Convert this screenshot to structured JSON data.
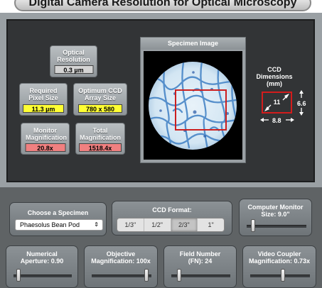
{
  "header": {
    "title": "Digital Camera Resolution for Optical Microscopy"
  },
  "readouts": {
    "optical_resolution": {
      "label": "Optical Resolution",
      "value": "0.3 µm"
    },
    "required_pixel_size": {
      "label": "Required Pixel Size",
      "value": "11.3 µm"
    },
    "optimum_ccd_array": {
      "label": "Optimum CCD Array Size",
      "value": "780 x 580"
    },
    "monitor_magnification": {
      "label": "Monitor Magnification",
      "value": "20.8x"
    },
    "total_magnification": {
      "label": "Total Magnification",
      "value": "1518.4x"
    }
  },
  "specimen_view": {
    "title": "Specimen Image"
  },
  "ccd": {
    "label": "CCD Dimensions (mm)",
    "diagonal": "11",
    "height": "6.6",
    "width": "8.8"
  },
  "controls": {
    "specimen": {
      "label": "Choose a Specimen",
      "selected": "Phaesolus Bean Pod"
    },
    "ccd_format": {
      "label": "CCD Format:",
      "options": [
        "1/3\"",
        "1/2\"",
        "2/3\"",
        "1\""
      ],
      "selected": "2/3\""
    },
    "monitor_size": {
      "label": "Computer Monitor Size: 9.0\"",
      "level": 0.08
    },
    "numerical_aperture": {
      "label": "Numerical Aperture: 0.90",
      "level": 0.05
    },
    "objective_magnification": {
      "label": "Objective Magnification: 100x",
      "level": 0.95
    },
    "field_number": {
      "label": "Field Number (FN): 24",
      "level": 0.1
    },
    "video_coupler": {
      "label": "Video Coupler Magnification: 0.73x",
      "level": 0.55
    }
  }
}
